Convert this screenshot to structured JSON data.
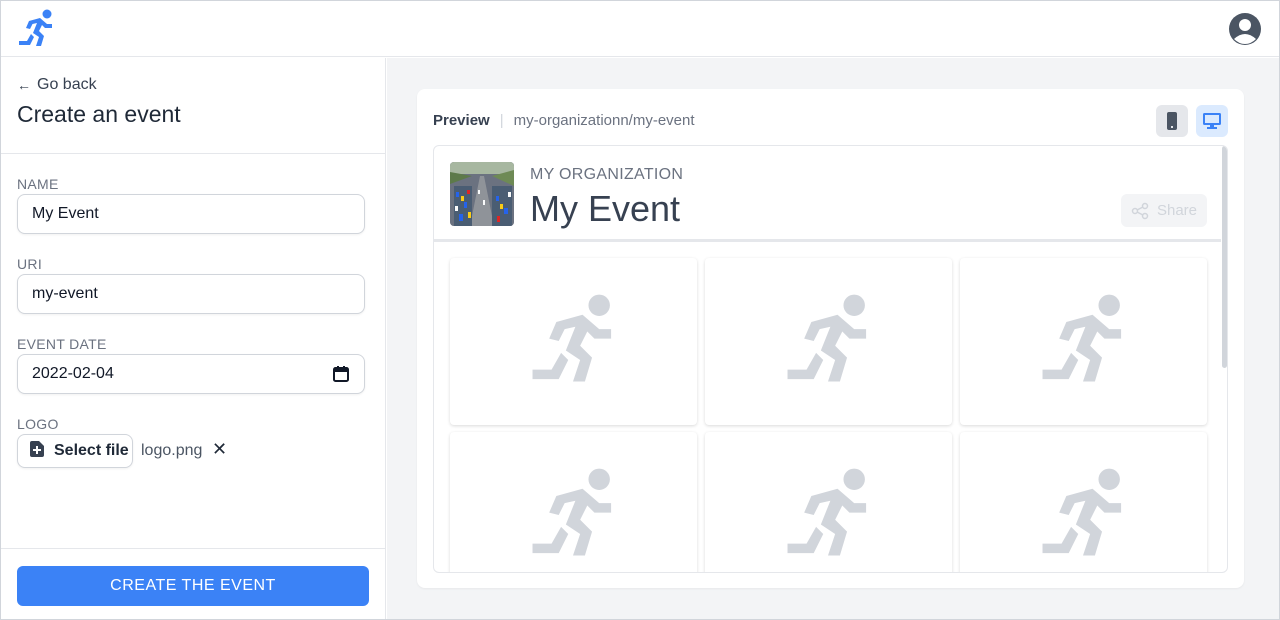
{
  "header": {
    "logo_icon": "running-man-logo",
    "avatar_icon": "user-circle-icon",
    "accent": "#3b82f6"
  },
  "sidebar": {
    "go_back_label": "Go back",
    "title": "Create an event",
    "fields": {
      "name": {
        "label": "NAME",
        "value": "My Event"
      },
      "uri": {
        "label": "URI",
        "value": "my-event"
      },
      "event_date": {
        "label": "EVENT DATE",
        "value": "2022-02-04"
      },
      "logo": {
        "label": "LOGO",
        "select_label": "Select file",
        "file_name": "logo.png",
        "remove_glyph": "✕"
      }
    },
    "create_label": "CREATE THE EVENT"
  },
  "preview": {
    "label": "Preview",
    "separator": "|",
    "path": "my-organizationn/my-event",
    "devices": [
      "mobile",
      "desktop"
    ],
    "selected_device": "desktop",
    "event": {
      "organization": "MY ORGANIZATION",
      "title": "My Event",
      "share_label": "Share"
    },
    "tiles": [
      {
        "icon": "runner-placeholder-icon"
      },
      {
        "icon": "runner-placeholder-icon"
      },
      {
        "icon": "runner-placeholder-icon"
      },
      {
        "icon": "runner-placeholder-icon"
      },
      {
        "icon": "runner-placeholder-icon"
      },
      {
        "icon": "runner-placeholder-icon"
      }
    ]
  }
}
